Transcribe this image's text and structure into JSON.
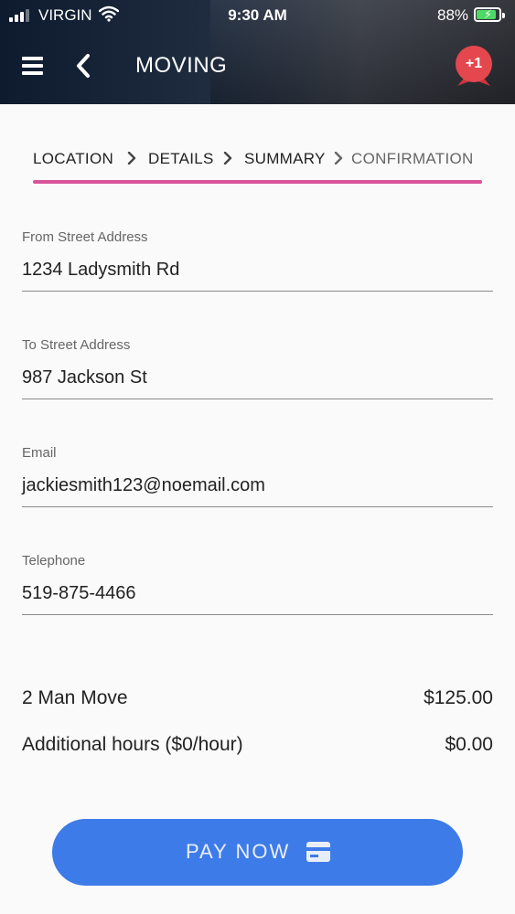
{
  "status_bar": {
    "carrier": "VIRGIN",
    "time": "9:30 AM",
    "battery_percent": "88%"
  },
  "header": {
    "title": "MOVING",
    "badge": "+1"
  },
  "steps": [
    {
      "label": "LOCATION",
      "active": true
    },
    {
      "label": "DETAILS",
      "active": true
    },
    {
      "label": "SUMMARY",
      "active": true
    },
    {
      "label": "CONFIRMATION",
      "active": false
    }
  ],
  "fields": {
    "from": {
      "label": "From Street Address",
      "value": "1234 Ladysmith Rd"
    },
    "to": {
      "label": "To Street Address",
      "value": "987 Jackson St"
    },
    "email": {
      "label": "Email",
      "value": "jackiesmith123@noemail.com"
    },
    "telephone": {
      "label": "Telephone",
      "value": "519-875-4466"
    }
  },
  "pricing": [
    {
      "name": "2 Man Move",
      "amount": "$125.00"
    },
    {
      "name": "Additional hours ($0/hour)",
      "amount": "$0.00"
    }
  ],
  "pay_button": {
    "label": "PAY NOW",
    "icon": "credit-card-icon"
  },
  "colors": {
    "accent_pink": "#d9549a",
    "button_blue": "#3d7be8",
    "badge_red": "#e5474f",
    "battery_green": "#4cd964"
  }
}
